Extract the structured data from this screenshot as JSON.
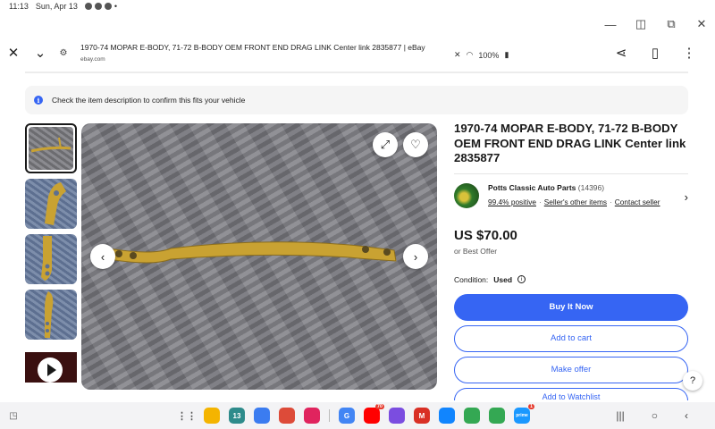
{
  "status": {
    "time": "11:13",
    "date": "Sun, Apr 13",
    "battery": "100%"
  },
  "browser": {
    "page_title": "1970-74 MOPAR E-BODY, 71-72 B-BODY OEM FRONT END DRAG LINK Center link 2835877 | eBay",
    "host": "ebay.com"
  },
  "notice": {
    "text": "Check the item description to confirm this fits your vehicle",
    "icon": "info-icon"
  },
  "gallery": {
    "thumbnail_count": 5,
    "has_video": true
  },
  "listing": {
    "title": "1970-74 MOPAR E-BODY, 71-72 B-BODY OEM FRONT END DRAG LINK Center link 2835877",
    "seller_name": "Potts Classic Auto Parts",
    "seller_count": "(14396)",
    "positive": "99.4% positive",
    "other_items": "Seller's other items",
    "contact": "Contact seller",
    "price": "US $70.00",
    "offer_note": "or Best Offer",
    "condition_label": "Condition:",
    "condition_value": "Used",
    "buy_now": "Buy It Now",
    "add_cart": "Add to cart",
    "make_offer": "Make offer",
    "watchlist": "Add to Watchlist"
  },
  "help": "?",
  "dock": {
    "apps": [
      {
        "name": "files-app",
        "color": "#f4b400",
        "label": ""
      },
      {
        "name": "calendar-app",
        "color": "#2e8b8b",
        "label": "13"
      },
      {
        "name": "messages-app",
        "color": "#3b7cf0",
        "label": ""
      },
      {
        "name": "chrome-app",
        "color": "#dd4b39",
        "label": ""
      },
      {
        "name": "screen-recorder-app",
        "color": "#e0245e",
        "label": ""
      },
      {
        "name": "google-app",
        "color": "#4285f4",
        "label": "G"
      },
      {
        "name": "youtube-app",
        "color": "#ff0000",
        "label": "",
        "badge": "70"
      },
      {
        "name": "galaxy-store-app",
        "color": "#7b4de0",
        "label": ""
      },
      {
        "name": "gmail-app",
        "color": "#d93025",
        "label": "M"
      },
      {
        "name": "bluesky-app",
        "color": "#1185fe",
        "label": ""
      },
      {
        "name": "games-app",
        "color": "#34a853",
        "label": ""
      },
      {
        "name": "maps-app",
        "color": "#34a853",
        "label": ""
      },
      {
        "name": "prime-video-app",
        "color": "#1a98ff",
        "label": "prime",
        "badge": "1"
      }
    ]
  }
}
